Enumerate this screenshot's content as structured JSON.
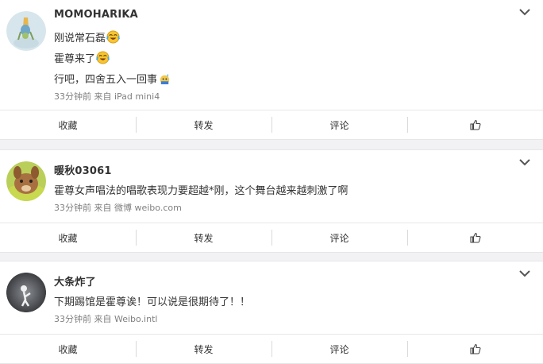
{
  "comments": [
    {
      "username": "MOMOHARIKA",
      "lines": [
        "刚说常石磊",
        "霍尊来了",
        "行吧，四舍五入一回事"
      ],
      "meta": "33分钟前 来自 iPad mini4",
      "actions": {
        "favorite": "收藏",
        "repost": "转发",
        "comment": "评论"
      }
    },
    {
      "username": "暖秋03061",
      "lines": [
        "霍尊女声唱法的唱歌表现力要超越*刚，这个舞台越来越刺激了啊"
      ],
      "meta": "33分钟前 来自 微博 weibo.com",
      "actions": {
        "favorite": "收藏",
        "repost": "转发",
        "comment": "评论"
      }
    },
    {
      "username": "大条炸了",
      "lines": [
        "下期踢馆是霍尊诶！可以说是很期待了！！"
      ],
      "meta": "33分钟前 来自 Weibo.intl",
      "actions": {
        "favorite": "收藏",
        "repost": "转发",
        "comment": "评论"
      }
    }
  ],
  "icons": {
    "expand": "chevron-down-icon",
    "like": "thumbs-up-icon",
    "laugh_emoji": "laughing-crying-emoji-icon",
    "sweat_emoji": "sweat-emoji-icon"
  }
}
